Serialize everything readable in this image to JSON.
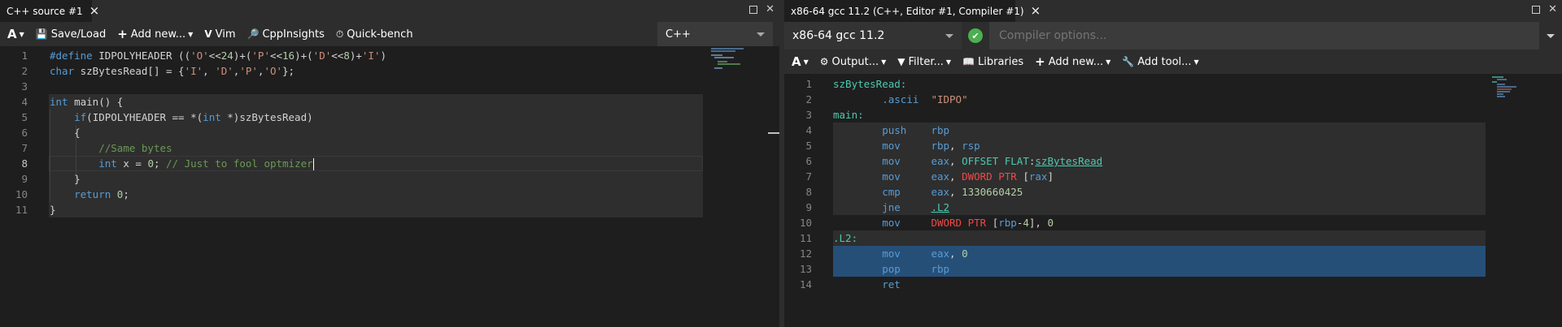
{
  "left": {
    "tab_title": "C++ source #1",
    "toolbar": {
      "font_btn": "A",
      "save_load": "Save/Load",
      "add_new": "Add new...",
      "vim": "Vim",
      "cpp_insights": "CppInsights",
      "quick_bench": "Quick-bench"
    },
    "language": "C++",
    "line_numbers": [
      "1",
      "2",
      "3",
      "4",
      "5",
      "6",
      "7",
      "8",
      "9",
      "10",
      "11"
    ]
  },
  "right": {
    "tab_title": "x86-64 gcc 11.2 (C++, Editor #1, Compiler #1)",
    "compiler": "x86-64 gcc 11.2",
    "compiler_options_placeholder": "Compiler options...",
    "toolbar": {
      "font_btn": "A",
      "output": "Output...",
      "filter": "Filter...",
      "libraries": "Libraries",
      "add_new": "Add new...",
      "add_tool": "Add tool..."
    },
    "line_numbers": [
      "1",
      "2",
      "3",
      "4",
      "5",
      "6",
      "7",
      "8",
      "9",
      "10",
      "11",
      "12",
      "13",
      "14"
    ]
  },
  "icons": {
    "close": "close-icon",
    "maximize": "maximize-icon",
    "save": "floppy-icon",
    "add": "plus-icon",
    "vim": "vim-icon",
    "insights": "magnifier-icon",
    "bench": "stopwatch-icon",
    "status": "check-circle-icon",
    "output": "gear-icon",
    "filter": "funnel-icon",
    "libraries": "book-icon",
    "tool": "wrench-icon"
  },
  "colors": {
    "background": "#1e1e1e",
    "toolbar": "#2d2d2d",
    "selection": "#264f78",
    "keyword": "#569cd6",
    "string": "#ce9178",
    "comment": "#6a9955",
    "status_ok": "#4caf50"
  }
}
